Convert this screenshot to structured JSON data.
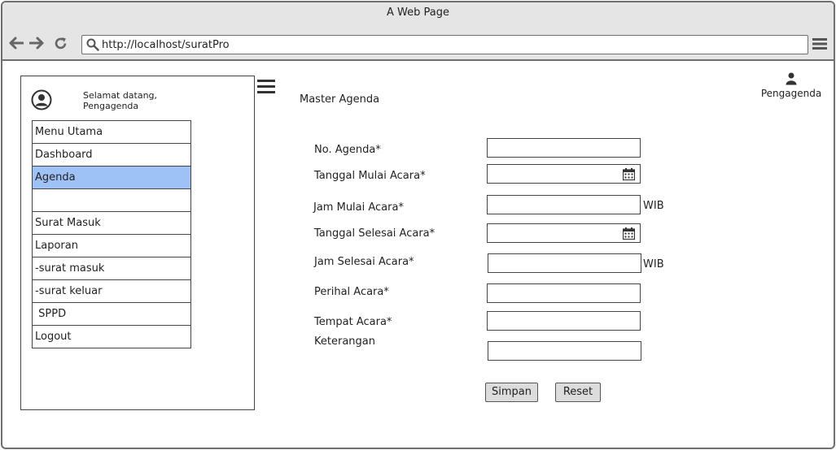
{
  "browser": {
    "title": "A Web Page",
    "url": "http://localhost/suratPro"
  },
  "sidebar": {
    "welcome_line1": "Selamat datang,",
    "welcome_line2": "Pengagenda",
    "items": [
      {
        "label": "Menu Utama"
      },
      {
        "label": "Dashboard"
      },
      {
        "label": "Agenda"
      },
      {
        "label": ""
      },
      {
        "label": "Surat Masuk"
      },
      {
        "label": "Laporan"
      },
      {
        "label": "-surat masuk"
      },
      {
        "label": "-surat keluar"
      },
      {
        "label": " SPPD"
      },
      {
        "label": "Logout"
      }
    ],
    "active_item": "Agenda",
    "active_color": "#9ec2f5"
  },
  "header": {
    "page_title": "Master Agenda",
    "user_label": "Pengagenda"
  },
  "form": {
    "no_agenda_label": "No. Agenda*",
    "tanggal_mulai_label": "Tanggal Mulai Acara*",
    "jam_mulai_label": "Jam Mulai Acara*",
    "jam_mulai_unit": "WIB",
    "tanggal_selesai_label": "Tanggal Selesai Acara*",
    "jam_selesai_label": "Jam Selesai Acara*",
    "jam_selesai_unit": "WIB",
    "perihal_label": "Perihal Acara*",
    "tempat_label": "Tempat Acara*",
    "keterangan_label": "Keterangan",
    "save_button": "Simpan",
    "reset_button": "Reset"
  },
  "icons": {
    "back": "arrow-left-icon",
    "forward": "arrow-right-icon",
    "reload": "reload-icon",
    "search": "search-icon",
    "browser_menu": "hamburger-menu-icon",
    "avatar": "user-circle-icon",
    "sidebar_toggle": "hamburger-menu-icon",
    "user": "user-icon",
    "calendar": "calendar-icon"
  }
}
